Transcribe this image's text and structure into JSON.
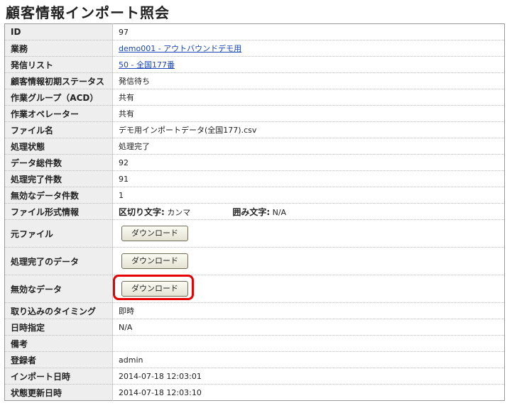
{
  "page_title": "顧客情報インポート照会",
  "rows": {
    "id": {
      "label": "ID",
      "value": "97"
    },
    "business": {
      "label": "業務",
      "value": "demo001 - アウトバウンドデモ用"
    },
    "call_list": {
      "label": "発信リスト",
      "value": "50 - 全国177番"
    },
    "initial_status": {
      "label": "顧客情報初期ステータス",
      "value": "発信待ち"
    },
    "work_group": {
      "label": "作業グループ（ACD）",
      "value": "共有"
    },
    "work_operator": {
      "label": "作業オペレーター",
      "value": "共有"
    },
    "file_name": {
      "label": "ファイル名",
      "value": "デモ用インポートデータ(全国177).csv"
    },
    "process_state": {
      "label": "処理状態",
      "value": "処理完了"
    },
    "total_count": {
      "label": "データ総件数",
      "value": "92"
    },
    "done_count": {
      "label": "処理完了件数",
      "value": "91"
    },
    "invalid_count": {
      "label": "無効なデータ件数",
      "value": "1"
    },
    "file_format": {
      "label": "ファイル形式情報",
      "delimiter_label": "区切り文字:",
      "delimiter_value": "カンマ",
      "quote_label": "囲み文字:",
      "quote_value": "N/A"
    },
    "original_file": {
      "label": "元ファイル",
      "button": "ダウンロード"
    },
    "processed_data": {
      "label": "処理完了のデータ",
      "button": "ダウンロード"
    },
    "invalid_data": {
      "label": "無効なデータ",
      "button": "ダウンロード"
    },
    "import_timing": {
      "label": "取り込みのタイミング",
      "value": "即時"
    },
    "datetime_spec": {
      "label": "日時指定",
      "value": "N/A"
    },
    "remarks": {
      "label": "備考",
      "value": ""
    },
    "registrant": {
      "label": "登録者",
      "value": "admin"
    },
    "import_datetime": {
      "label": "インポート日時",
      "value": "2014-07-18 12:03:01"
    },
    "status_updated": {
      "label": "状態更新日時",
      "value": "2014-07-18 12:03:10"
    }
  },
  "colors": {
    "highlight": "#e60000",
    "link": "#1a44b8",
    "key_bg": "#eeeeee"
  }
}
